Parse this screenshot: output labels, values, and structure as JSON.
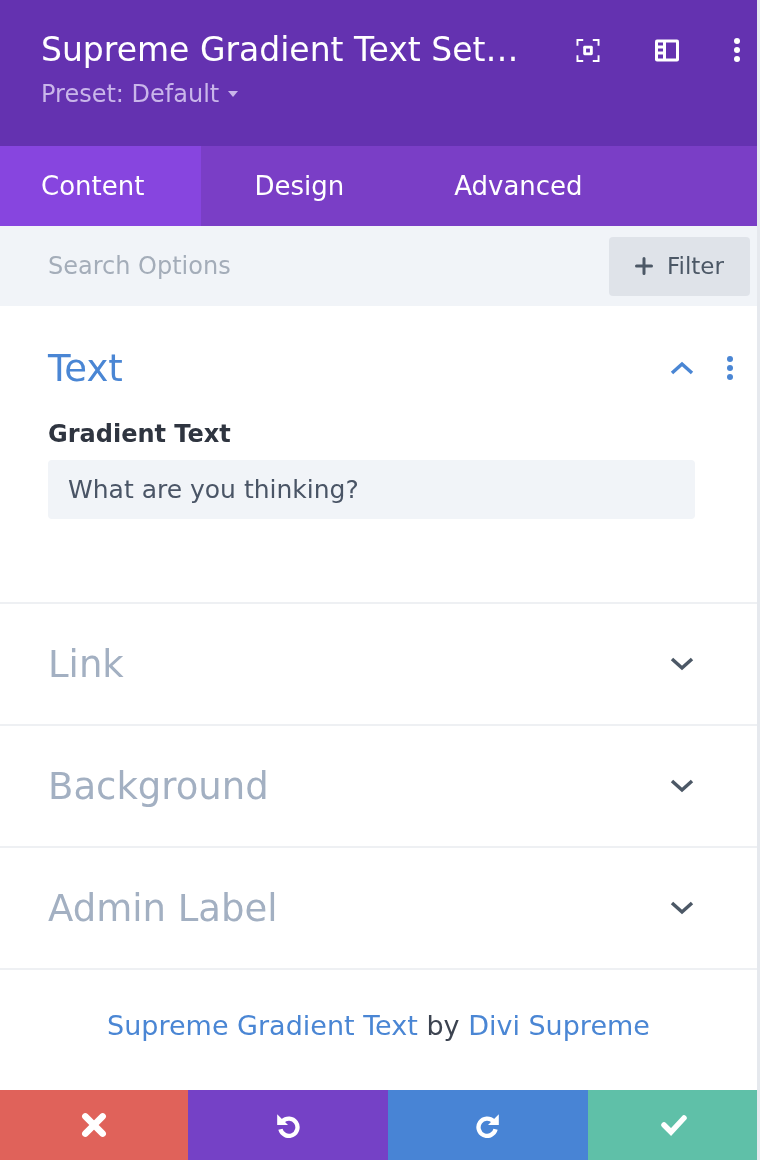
{
  "header": {
    "title": "Supreme Gradient Text Set…",
    "preset": "Preset: Default"
  },
  "tabs": [
    {
      "label": "Content",
      "selected": true
    },
    {
      "label": "Design",
      "selected": false
    },
    {
      "label": "Advanced",
      "selected": false
    }
  ],
  "search": {
    "placeholder": "Search Options"
  },
  "filter_button": {
    "label": "Filter"
  },
  "sections": [
    {
      "title": "Text",
      "expanded": true,
      "fields": [
        {
          "label": "Gradient Text",
          "value": "What are you thinking?"
        }
      ]
    },
    {
      "title": "Link",
      "expanded": false
    },
    {
      "title": "Background",
      "expanded": false
    },
    {
      "title": "Admin Label",
      "expanded": false
    }
  ],
  "credit": [
    {
      "kind": "link",
      "text": "Supreme Gradient Text"
    },
    {
      "kind": "plain",
      "text": "by"
    },
    {
      "kind": "link",
      "text": "Divi Supreme"
    }
  ],
  "action_buttons": [
    {
      "kind": "discard"
    },
    {
      "kind": "undo"
    },
    {
      "kind": "redo"
    },
    {
      "kind": "save"
    }
  ]
}
